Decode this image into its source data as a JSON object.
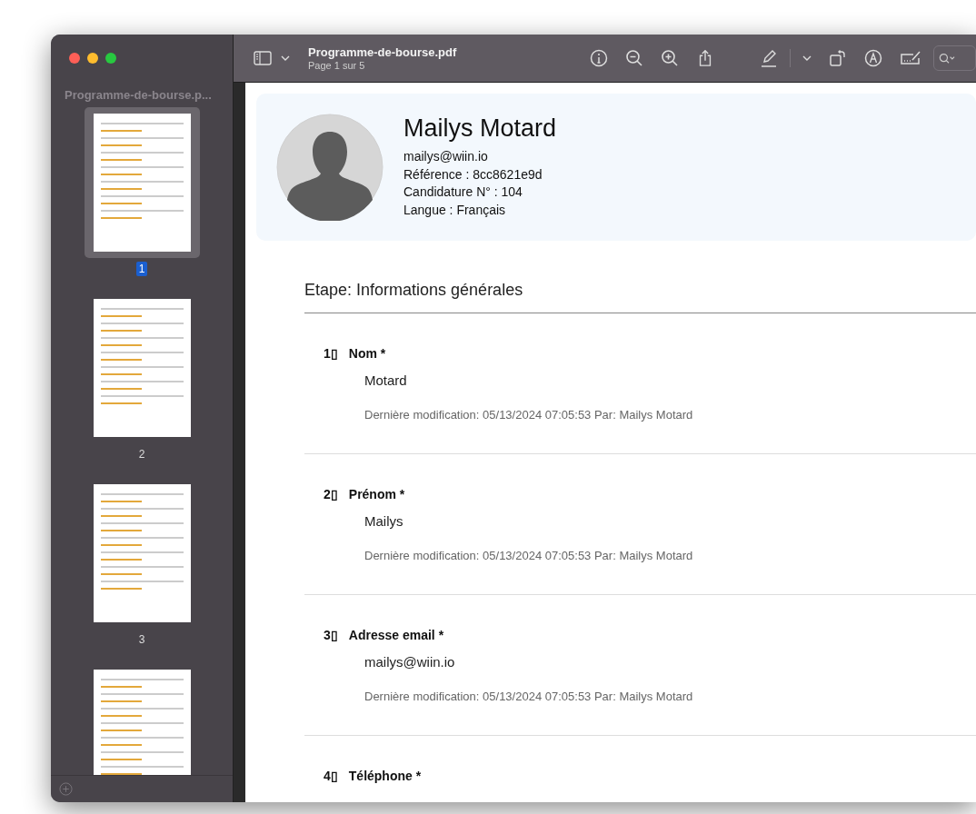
{
  "window": {
    "title": "Programme-de-bourse.pdf",
    "subtitle": "Page 1 sur 5"
  },
  "sidebar": {
    "title": "Programme-de-bourse.p...",
    "thumbnails": [
      {
        "label": "1",
        "selected": true
      },
      {
        "label": "2",
        "selected": false
      },
      {
        "label": "3",
        "selected": false
      },
      {
        "selected": false
      }
    ]
  },
  "profile": {
    "name": "Mailys Motard",
    "lines": [
      "mailys@wiin.io",
      "Référence : 8cc8621e9d",
      "Candidature N° : 104",
      "Langue : Français"
    ]
  },
  "section_title": "Etape: Informations générales",
  "questions": [
    {
      "number": "1▯",
      "label": "Nom *",
      "value": "Motard",
      "meta": "Dernière modification: 05/13/2024 07:05:53 Par: Mailys Motard"
    },
    {
      "number": "2▯",
      "label": "Prénom *",
      "value": "Mailys",
      "meta": "Dernière modification: 05/13/2024 07:05:53 Par: Mailys Motard"
    },
    {
      "number": "3▯",
      "label": "Adresse email *",
      "value": "mailys@wiin.io",
      "meta": "Dernière modification: 05/13/2024 07:05:53 Par: Mailys Motard"
    },
    {
      "number": "4▯",
      "label": "Téléphone *"
    }
  ]
}
